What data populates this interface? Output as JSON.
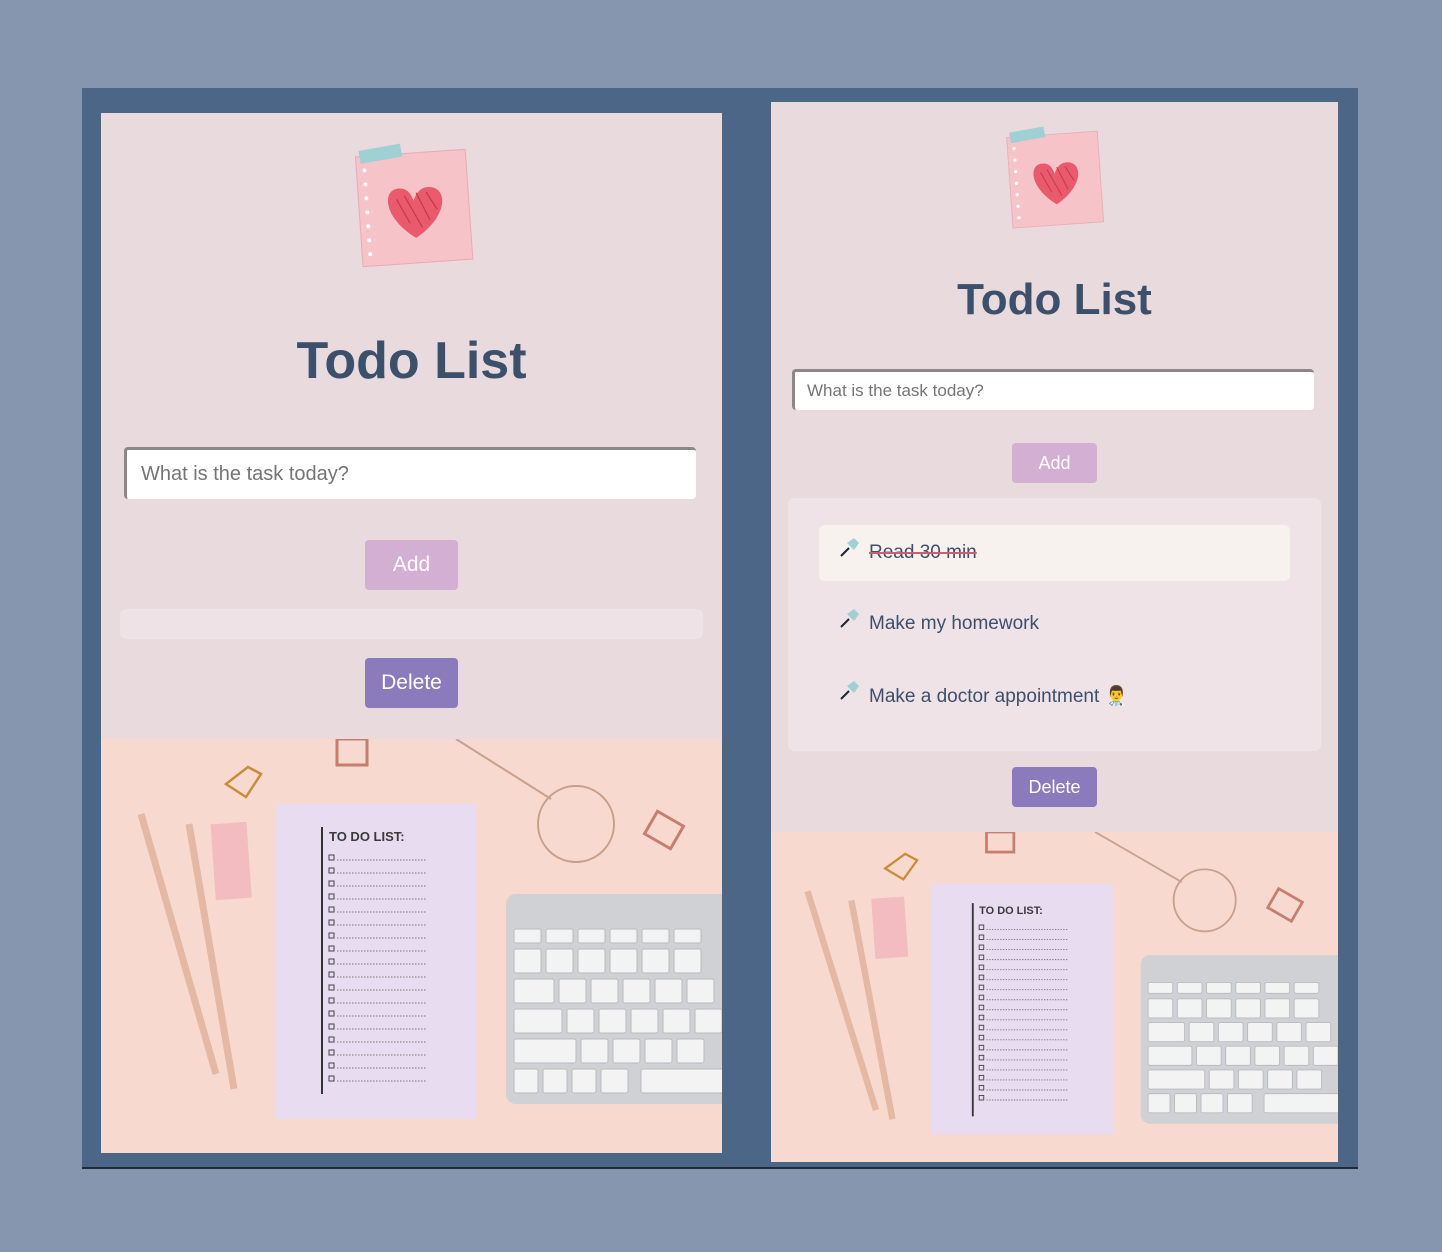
{
  "left_screen": {
    "title": "Todo List",
    "input_placeholder": "What is the task today?",
    "add_label": "Add",
    "delete_label": "Delete",
    "photo_caption": "TO DO LIST:"
  },
  "right_screen": {
    "title": "Todo List",
    "input_placeholder": "What is the task today?",
    "add_label": "Add",
    "delete_label": "Delete",
    "tasks": [
      {
        "text": "Read 30 min",
        "done": true
      },
      {
        "text": "Make my homework",
        "done": false
      },
      {
        "text": "Make a doctor appointment 👨‍⚕️",
        "done": false
      }
    ],
    "photo_caption": "TO DO LIST:"
  },
  "colors": {
    "page_bg": "#8796af",
    "frame": "#4b6686",
    "panel": "#e8dadd",
    "title": "#3c4f6b",
    "add_button": "#d3afd4",
    "delete_button": "#8b7bbd",
    "strike": "#d35a73"
  },
  "icons": [
    "heart-sticky-note-icon",
    "pin-icon"
  ]
}
